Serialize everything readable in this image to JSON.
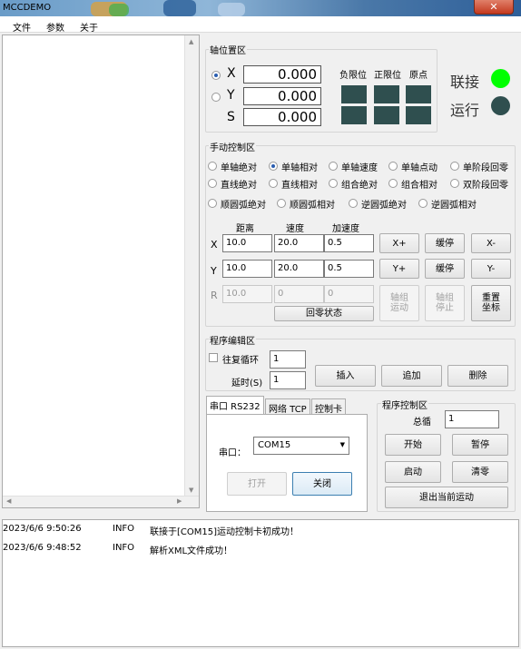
{
  "window": {
    "title": "MCCDEMO",
    "close_glyph": "✕"
  },
  "menu": [
    "文件",
    "参数",
    "关于"
  ],
  "icons": {
    "up": "▲",
    "down": "▼",
    "left": "◀",
    "right": "▶"
  },
  "axis_group": {
    "title": "轴位置区",
    "axes": [
      {
        "name": "X",
        "value": "0.000",
        "selected": true
      },
      {
        "name": "Y",
        "value": "0.000",
        "selected": false
      },
      {
        "name": "S",
        "value": "0.000"
      }
    ],
    "limit_labels": [
      "负限位",
      "正限位",
      "原点"
    ]
  },
  "status": {
    "connected_label": "联接",
    "connected_color": "#00ff00",
    "running_label": "运行",
    "running_color": "#2f4f4f"
  },
  "manual": {
    "title": "手动控制区",
    "modes": [
      [
        "单轴绝对",
        "单轴相对",
        "单轴速度",
        "单轴点动",
        "单阶段回零"
      ],
      [
        "直线绝对",
        "直线相对",
        "组合绝对",
        "组合相对",
        "双阶段回零"
      ],
      [
        "顺圆弧绝对",
        "顺圆弧相对",
        "逆圆弧绝对",
        "逆圆弧相对"
      ]
    ],
    "selected_mode": "单轴相对",
    "headers": [
      "距离",
      "速度",
      "加速度"
    ],
    "rows": [
      {
        "axis": "X",
        "distance": "10.0",
        "speed": "20.0",
        "accel": "0.5",
        "plus": "X+",
        "pause": "缓停",
        "minus": "X-"
      },
      {
        "axis": "Y",
        "distance": "10.0",
        "speed": "20.0",
        "accel": "0.5",
        "plus": "Y+",
        "pause": "缓停",
        "minus": "Y-"
      },
      {
        "axis": "R",
        "distance": "10.0",
        "speed": "0",
        "accel": "0"
      }
    ],
    "homing_status": "回零状态",
    "group_move": "轴组\n运动",
    "group_stop": "轴组\n停止",
    "reset_coords": "重置\n坐标"
  },
  "program_edit": {
    "title": "程序编辑区",
    "loop_label": "往复循环",
    "loop_value": "1",
    "delay_label": "延时(S)",
    "delay_value": "1",
    "insert": "插入",
    "append": "追加",
    "delete": "删除"
  },
  "comm": {
    "tabs": [
      "串口 RS232",
      "网络 TCP",
      "控制卡"
    ],
    "port_label": "串口：",
    "port_value": "COM15",
    "open": "打开",
    "close": "关闭"
  },
  "program_control": {
    "title": "程序控制区",
    "total_label": "总循",
    "total_value": "1",
    "start": "开始",
    "pause": "暂停",
    "launch": "启动",
    "clear": "清零",
    "exit_motion": "退出当前运动"
  },
  "log": [
    {
      "time": "2023/6/6 9:50:26",
      "level": "INFO",
      "message": "联接于[COM15]运动控制卡初成功！"
    },
    {
      "time": "2023/6/6 9:48:52",
      "level": "INFO",
      "message": "解析XML文件成功！"
    }
  ]
}
